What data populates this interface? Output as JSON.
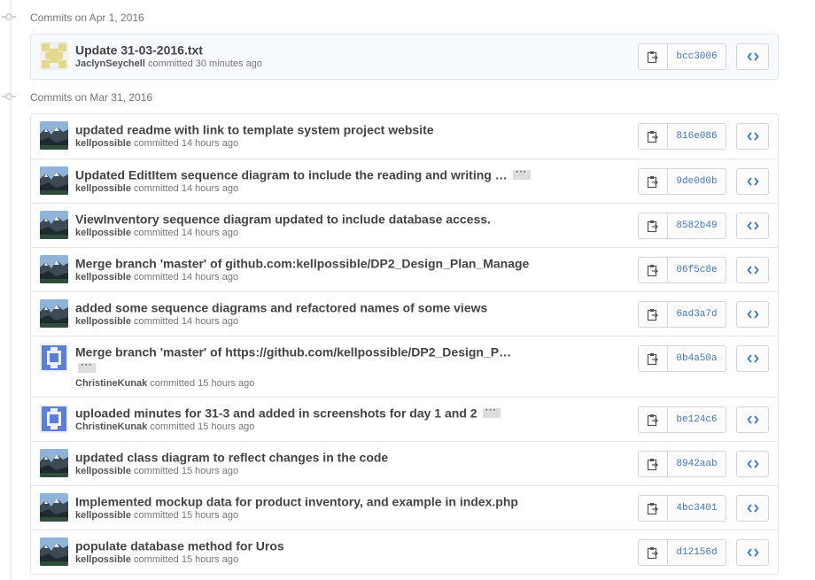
{
  "days": [
    {
      "label": "Commits on Apr 1, 2016",
      "commits": [
        {
          "title": "Update 31-03-2016.txt",
          "author": "JaclynSeychell",
          "verb": "committed",
          "time": "30 minutes ago",
          "sha": "bcc3006",
          "avatar": "identicon-yellow",
          "has_more": false
        }
      ]
    },
    {
      "label": "Commits on Mar 31, 2016",
      "commits": [
        {
          "title": "updated readme with link to template system project website",
          "author": "kellpossible",
          "verb": "committed",
          "time": "14 hours ago",
          "sha": "816e086",
          "avatar": "mountain-photo",
          "has_more": false
        },
        {
          "title": "Updated EditItem sequence diagram to include the reading and writing …",
          "author": "kellpossible",
          "verb": "committed",
          "time": "14 hours ago",
          "sha": "9de0d0b",
          "avatar": "mountain-photo",
          "has_more": true
        },
        {
          "title": "ViewInventory sequence diagram updated to include database access.",
          "author": "kellpossible",
          "verb": "committed",
          "time": "14 hours ago",
          "sha": "8582b49",
          "avatar": "mountain-photo",
          "has_more": false
        },
        {
          "title": "Merge branch 'master' of github.com:kellpossible/DP2_Design_Plan_Manage",
          "author": "kellpossible",
          "verb": "committed",
          "time": "14 hours ago",
          "sha": "06f5c8e",
          "avatar": "mountain-photo",
          "has_more": false
        },
        {
          "title": "added some sequence diagrams and refactored names of some views",
          "author": "kellpossible",
          "verb": "committed",
          "time": "14 hours ago",
          "sha": "6ad3a7d",
          "avatar": "mountain-photo",
          "has_more": false
        },
        {
          "title": "Merge branch 'master' of https://github.com/kellpossible/DP2_Design_P…",
          "author": "ChristineKunak",
          "verb": "committed",
          "time": "15 hours ago",
          "sha": "0b4a50a",
          "avatar": "identicon-blue",
          "has_more": true,
          "wrap": true
        },
        {
          "title": "uploaded minutes for 31-3 and added in screenshots for day 1 and 2",
          "author": "ChristineKunak",
          "verb": "committed",
          "time": "15 hours ago",
          "sha": "be124c6",
          "avatar": "identicon-blue",
          "has_more": true
        },
        {
          "title": "updated class diagram to reflect changes in the code",
          "author": "kellpossible",
          "verb": "committed",
          "time": "15 hours ago",
          "sha": "8942aab",
          "avatar": "mountain-photo",
          "has_more": false
        },
        {
          "title": "Implemented mockup data for product inventory, and example in index.php",
          "author": "kellpossible",
          "verb": "committed",
          "time": "15 hours ago",
          "sha": "4bc3401",
          "avatar": "mountain-photo",
          "has_more": false
        },
        {
          "title": "populate database method for Uros",
          "author": "kellpossible",
          "verb": "committed",
          "time": "15 hours ago",
          "sha": "d12156d",
          "avatar": "mountain-photo",
          "has_more": false
        }
      ]
    }
  ],
  "icons": {
    "copy": "clipboard-icon",
    "browse": "code-brackets-icon",
    "timeline": "commit-dot-icon",
    "more": "ellipsis-icon"
  },
  "colors": {
    "sha": "#4078c0",
    "identicon_yellow": "#e6dd8f",
    "identicon_blue": "#5a7fd6"
  }
}
